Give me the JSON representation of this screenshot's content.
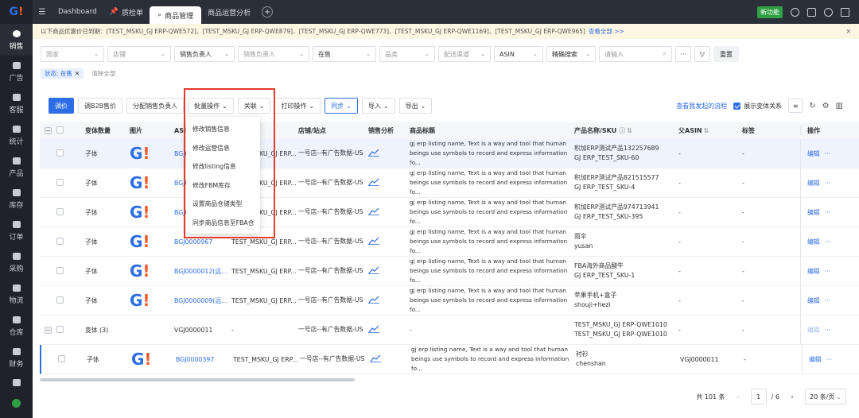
{
  "sidebar": {
    "items": [
      {
        "label": "销售",
        "icon": "chat-bubble-icon",
        "active": true
      },
      {
        "label": "广告",
        "icon": "ad-icon"
      },
      {
        "label": "客服",
        "icon": "headset-icon"
      },
      {
        "label": "统计",
        "icon": "chart-icon"
      },
      {
        "label": "产品",
        "icon": "cube-icon"
      },
      {
        "label": "库存",
        "icon": "warehouse-icon"
      },
      {
        "label": "订单",
        "icon": "order-icon"
      },
      {
        "label": "采购",
        "icon": "cart-icon"
      },
      {
        "label": "物流",
        "icon": "truck-icon"
      },
      {
        "label": "仓库",
        "icon": "store-icon"
      },
      {
        "label": "财务",
        "icon": "money-bag-icon"
      }
    ]
  },
  "topbar": {
    "tabs": [
      {
        "label": "Dashboard"
      },
      {
        "label": "质检单",
        "icon": "pin-icon"
      },
      {
        "label": "商品管理",
        "icon": "search-icon",
        "active": true
      },
      {
        "label": "商品运营分析"
      }
    ],
    "new_feature": "新功能"
  },
  "notice": {
    "text": "以下商品优惠价已到期：[TEST_MSKU_GJ ERP-QWE572]、[TEST_MSKU_GJ ERP-QWE879]、[TEST_MSKU_GJ ERP-QWE773]、[TEST_MSKU_GJ ERP-QWE1169]、[TEST_MSKU_GJ ERP-QWE965]",
    "more": "查看全部 >>"
  },
  "filters": {
    "country": "国家",
    "shop": "店铺",
    "sales_owner": "销售负责人",
    "sales_owner2": "销售负责人",
    "status": "在售",
    "category": "品类",
    "channel": "配送渠道",
    "asin": "ASIN",
    "match": "精确搜索",
    "search_placeholder": "请输入",
    "reset": "重置"
  },
  "status_filter": {
    "chip": "状态: 在售",
    "clear": "清除全部"
  },
  "toolbar": {
    "buttons": [
      "调价",
      "调B2B售价",
      "分配销售负责人",
      "批量操作",
      "关联",
      "打印操作",
      "同步",
      "导入",
      "导出"
    ],
    "my_flow": "查看我发起的流程",
    "show_variant": "展示变体关系"
  },
  "dropdown": {
    "items": [
      "修改销售信息",
      "修改运营信息",
      "修改listing信息",
      "修改FBM库存",
      "设置商品仓储类型",
      "同步商品信息至FBA仓"
    ]
  },
  "table": {
    "headers": [
      "变体数量",
      "图片",
      "ASIN",
      "",
      "店铺/站点",
      "销售分析",
      "商品标题",
      "产品名称/SKU",
      "父ASIN",
      "标签",
      "操作"
    ],
    "rows": [
      {
        "variant": "子体",
        "asin": "BGJ0",
        "msku": "TEST_MSKU_GJ ERP...",
        "shop": "一号店--有广告数据-US",
        "title": "gj erp listing name, Text is a way and tool that human beings use symbols to record and express information fo...",
        "product": "积加ERP测试产品132257689",
        "sku": "GJ ERP_TEST_SKU-60",
        "parent": "-",
        "tag": "-",
        "edit": "编辑",
        "highlight": true
      },
      {
        "variant": "子体",
        "asin": "BGJ0",
        "msku": "TEST_MSKU_GJ ERP...",
        "shop": "一号店--有广告数据-US",
        "title": "gj erp listing name, Text is a way and tool that human beings use symbols to record and express information fo...",
        "product": "积加ERP测试产品821515577",
        "sku": "GJ ERP_TEST_SKU-4",
        "parent": "-",
        "tag": "-",
        "edit": "编辑"
      },
      {
        "variant": "子体",
        "asin": "BGJ0",
        "msku": "TEST_MSKU_GJ ERP...",
        "shop": "一号店--有广告数据-US",
        "title": "gj erp listing name, Text is a way and tool that human beings use symbols to record and express information fo...",
        "product": "积加ERP测试产品974713941",
        "sku": "GJ ERP_TEST_SKU-395",
        "parent": "-",
        "tag": "-",
        "edit": "编辑"
      },
      {
        "variant": "子体",
        "asin": "BGJ0000967",
        "msku": "TEST_MSKU_GJ ERP...",
        "shop": "一号店--有广告数据-US",
        "title": "gj erp listing name, Text is a way and tool that human beings use symbols to record and express information fo...",
        "product": "雨伞",
        "sku": "yusan",
        "parent": "-",
        "tag": "-",
        "edit": "编辑"
      },
      {
        "variant": "子体",
        "asin": "BGJ0000012(远...",
        "msku": "TEST_MSKU_GJ ERP...",
        "shop": "一号店--有广告数据-US",
        "title": "gj erp listing name, Text is a way and tool that human beings use symbols to record and express information fo...",
        "product": "FBA海外商品酸牛",
        "sku": "GJ ERP_TEST_SKU-1",
        "parent": "-",
        "tag": "-",
        "edit": "编辑"
      },
      {
        "variant": "子体",
        "asin": "BGJ0000009(远...",
        "msku": "TEST_MSKU_GJ ERP...",
        "shop": "一号店--有广告数据-US",
        "title": "gj erp listing name, Text is a way and tool that human beings use symbols to record and express information fo...",
        "product": "苹果手机+盒子",
        "sku": "shouji+hezi",
        "parent": "-",
        "tag": "-",
        "edit": "编辑"
      },
      {
        "variant": "变体 (3)",
        "asin": "VGJ0000011",
        "msku": "-",
        "shop": "一号店--有广告数据-US",
        "title": "-",
        "product": "TEST_MSKU_GJ ERP-QWE1010",
        "sku": "TEST_MSKU_GJ ERP-QWE1010",
        "parent": "-",
        "tag": "-",
        "edit": "编辑",
        "variant_row": true
      },
      {
        "variant": "子体",
        "asin": "BGJ0000397",
        "msku": "TEST_MSKU_GJ ERP...",
        "shop": "一号店--有广告数据-US",
        "title": "gj erp listing name, Text is a way and tool that human beings use symbols to record and express information fo...",
        "product": "衬衫",
        "sku": "chenshan",
        "parent": "VGJ0000011",
        "tag": "-",
        "edit": "编辑",
        "selected": true
      }
    ]
  },
  "pager": {
    "total": "共 101 条",
    "page": "1",
    "pages": "/ 6",
    "size": "20 条/页"
  }
}
